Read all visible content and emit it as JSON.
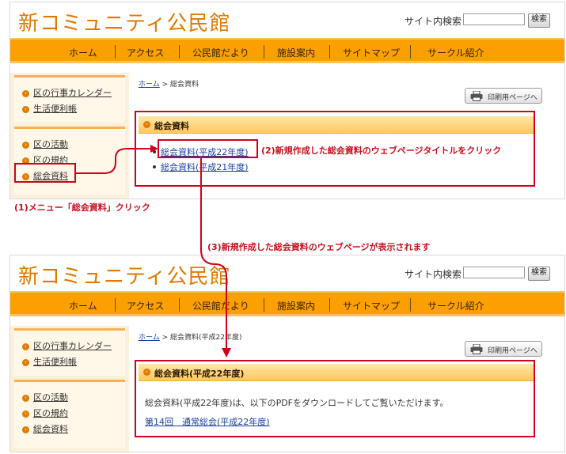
{
  "site": {
    "title": "新コミュニティ公民館",
    "search_label": "サイト内検索",
    "search_value": "",
    "search_button": "検索"
  },
  "nav": [
    "ホーム",
    "アクセス",
    "公民館だより",
    "施設案内",
    "サイトマップ",
    "サークル紹介"
  ],
  "sidebar": {
    "group1": [
      "区の行事カレンダー",
      "生活便利帳"
    ],
    "group2": [
      "区の活動",
      "区の規約",
      "総会資料"
    ]
  },
  "print_button": "印刷用ページへ",
  "screen1": {
    "breadcrumb_home": "ホーム",
    "breadcrumb_sep": ">",
    "breadcrumb_current": "総会資料",
    "section_title": "総会資料",
    "list": [
      "総会資料(平成22年度)",
      "総会資料(平成21年度)"
    ]
  },
  "screen2": {
    "breadcrumb_home": "ホーム",
    "breadcrumb_sep": ">",
    "breadcrumb_current": "総会資料(平成22年度)",
    "section_title": "総会資料(平成22年度)",
    "body_text": "総会資料(平成22年度)は、以下のPDFをダウンロードしてご覧いただけます。",
    "link": "第14回　通常総会(平成22年度)"
  },
  "annotations": {
    "step1": "(1)メニュー「総会資料」クリック",
    "step2": "(2)新規作成した総会資料のウェブページタイトルをクリック",
    "step3": "(3)新規作成した総会資料のウェブページが表示されます"
  },
  "colors": {
    "accent": "#fba000",
    "title": "#e07800",
    "annotation": "#d0021b",
    "link": "#1a3fa0"
  }
}
